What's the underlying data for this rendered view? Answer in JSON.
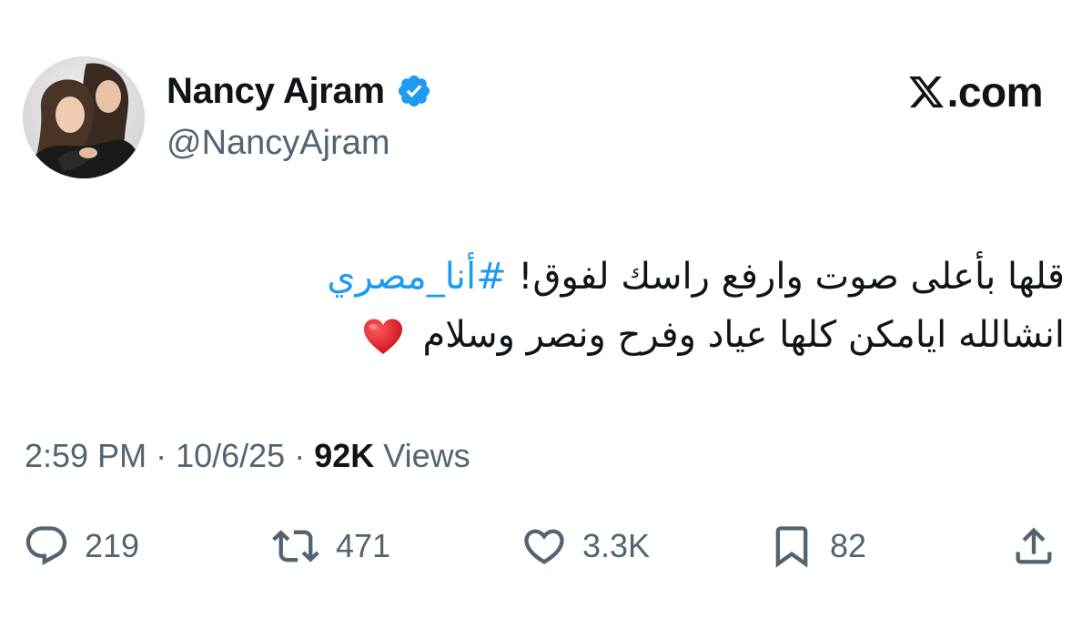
{
  "author": {
    "display_name": "Nancy Ajram",
    "handle": "@NancyAjram",
    "verified": true,
    "avatar_icon": "profile-photo"
  },
  "brand": {
    "text": ".com",
    "logo_icon": "x-logo-icon"
  },
  "tweet": {
    "line1_text": "قلها بأعلى صوت وارفع راسك لفوق! ",
    "line1_hashtag": "#أنا_مصري",
    "line2_text": "انشالله ايامكن كلها عياد وفرح ونصر وسلام",
    "line2_emoji": "red-heart-emoji",
    "hashtag_color": "#1d9bf0"
  },
  "meta": {
    "time": "2:59 PM",
    "separator": " · ",
    "date": "10/6/25",
    "views_count": "92K",
    "views_label": " Views"
  },
  "actions": {
    "replies": "219",
    "reposts": "471",
    "likes": "3.3K",
    "bookmarks": "82"
  },
  "colors": {
    "text_primary": "#0f1419",
    "text_secondary": "#536471",
    "verified_blue": "#1d9bf0"
  }
}
